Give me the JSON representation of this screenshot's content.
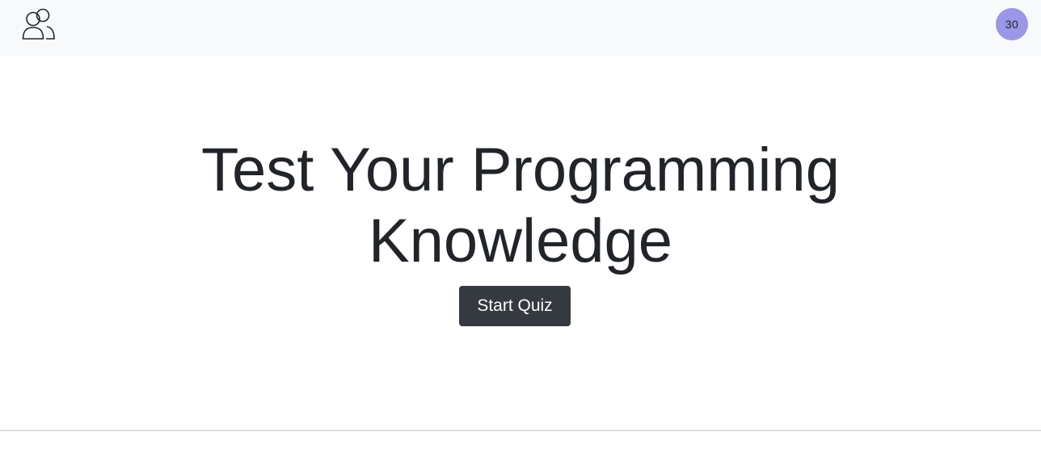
{
  "navbar": {
    "logo_icon": "users-icon",
    "avatar_text": "30",
    "avatar_color": "#9b96e6"
  },
  "hero": {
    "title_line1": "Test Your Programming",
    "title_line2": "Knowledge",
    "start_button_label": "Start Quiz"
  },
  "colors": {
    "navbar_bg": "#f8f9fa",
    "button_bg": "#343a40",
    "text": "#212529"
  }
}
